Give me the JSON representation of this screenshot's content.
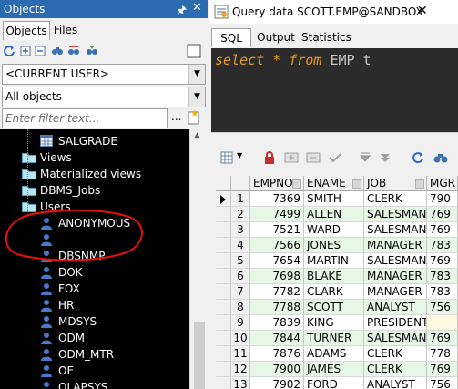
{
  "objects_panel": {
    "title": "Objects",
    "tabs": [
      "Objects",
      "Files"
    ],
    "owner_select": "<CURRENT USER>",
    "type_select": "All objects",
    "filter_placeholder": "Enter filter text...",
    "filter_more": "...",
    "tree": [
      {
        "label": "SALGRADE",
        "icon": "table-icon"
      },
      {
        "label": "Views",
        "icon": "folder-icon"
      },
      {
        "label": "Materialized views",
        "icon": "folder-icon"
      },
      {
        "label": "DBMS_Jobs",
        "icon": "folder-icon"
      },
      {
        "label": "Users",
        "icon": "folder-icon"
      },
      {
        "label": "ANONYMOUS",
        "icon": "user-icon"
      },
      {
        "label": "",
        "icon": "user-icon"
      },
      {
        "label": "DBSNMP",
        "icon": "user-icon"
      },
      {
        "label": "DOK",
        "icon": "user-icon"
      },
      {
        "label": "FOX",
        "icon": "user-icon"
      },
      {
        "label": "HR",
        "icon": "user-icon"
      },
      {
        "label": "MDSYS",
        "icon": "user-icon"
      },
      {
        "label": "ODM",
        "icon": "user-icon"
      },
      {
        "label": "ODM_MTR",
        "icon": "user-icon"
      },
      {
        "label": "OE",
        "icon": "user-icon"
      },
      {
        "label": "OLAPSYS",
        "icon": "user-icon"
      }
    ]
  },
  "query_window": {
    "title": "Query data SCOTT.EMP@SANDBOX",
    "tabs": [
      "SQL",
      "Output",
      "Statistics"
    ],
    "sql": {
      "kw_select": "select",
      "star": "*",
      "kw_from": "from",
      "rest": "EMP t"
    },
    "columns": [
      "EMPNO",
      "ENAME",
      "JOB",
      "MGR"
    ],
    "rows": [
      {
        "n": "1",
        "empno": "7369",
        "ename": "SMITH",
        "job": "CLERK",
        "mgr": "790"
      },
      {
        "n": "2",
        "empno": "7499",
        "ename": "ALLEN",
        "job": "SALESMAN",
        "mgr": "769"
      },
      {
        "n": "3",
        "empno": "7521",
        "ename": "WARD",
        "job": "SALESMAN",
        "mgr": "769"
      },
      {
        "n": "4",
        "empno": "7566",
        "ename": "JONES",
        "job": "MANAGER",
        "mgr": "783"
      },
      {
        "n": "5",
        "empno": "7654",
        "ename": "MARTIN",
        "job": "SALESMAN",
        "mgr": "769"
      },
      {
        "n": "6",
        "empno": "7698",
        "ename": "BLAKE",
        "job": "MANAGER",
        "mgr": "783"
      },
      {
        "n": "7",
        "empno": "7782",
        "ename": "CLARK",
        "job": "MANAGER",
        "mgr": "783"
      },
      {
        "n": "8",
        "empno": "7788",
        "ename": "SCOTT",
        "job": "ANALYST",
        "mgr": "756"
      },
      {
        "n": "9",
        "empno": "7839",
        "ename": "KING",
        "job": "PRESIDENT",
        "mgr": ""
      },
      {
        "n": "10",
        "empno": "7844",
        "ename": "TURNER",
        "job": "SALESMAN",
        "mgr": "769"
      },
      {
        "n": "11",
        "empno": "7876",
        "ename": "ADAMS",
        "job": "CLERK",
        "mgr": "778"
      },
      {
        "n": "12",
        "empno": "7900",
        "ename": "JAMES",
        "job": "CLERK",
        "mgr": "769"
      },
      {
        "n": "13",
        "empno": "7902",
        "ename": "FORD",
        "job": "ANALYST",
        "mgr": "756"
      }
    ]
  },
  "colors": {
    "panel_title": "#2b6cb0",
    "editor_bg": "#2b2b2b",
    "keyword": "#e69a28",
    "annotation": "#e01010"
  }
}
